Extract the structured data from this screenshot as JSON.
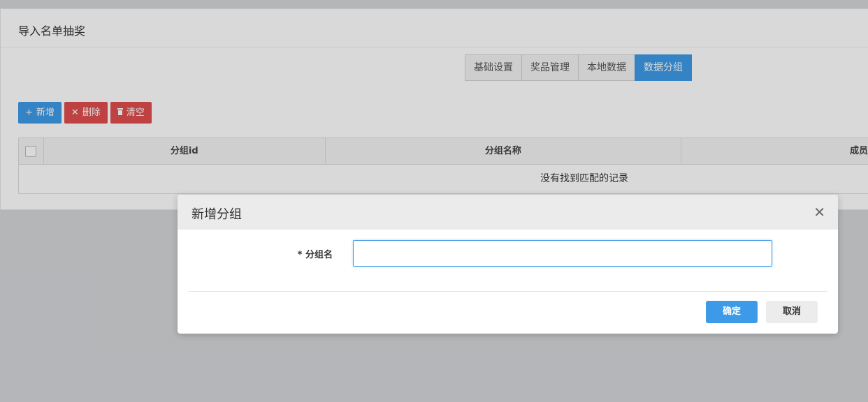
{
  "panel": {
    "title": "导入名单抽奖"
  },
  "tabs": [
    {
      "label": "基础设置",
      "active": false
    },
    {
      "label": "奖品管理",
      "active": false
    },
    {
      "label": "本地数据",
      "active": false
    },
    {
      "label": "数据分组",
      "active": true
    }
  ],
  "toolbar": {
    "add_label": "新增",
    "delete_label": "删除",
    "clear_label": "清空"
  },
  "table": {
    "columns": [
      "分组id",
      "分组名称",
      "成员数"
    ],
    "empty_message": "没有找到匹配的记录"
  },
  "modal": {
    "title": "新增分组",
    "field_label": "* 分组名",
    "field_value": "",
    "confirm_label": "确定",
    "cancel_label": "取消"
  },
  "colors": {
    "primary": "#3c9ae8",
    "danger": "#e14e4e"
  }
}
